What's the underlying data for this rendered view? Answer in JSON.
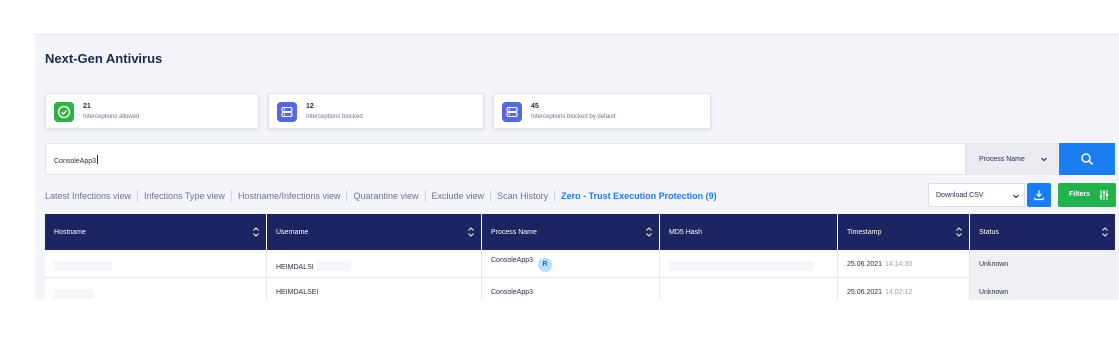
{
  "page": {
    "title": "Next-Gen Antivirus"
  },
  "stats": [
    {
      "count": "21",
      "label": "Interceptions allowed",
      "icon": "check-icon",
      "color": "#2fb344"
    },
    {
      "count": "12",
      "label": "Interceptions blocked",
      "icon": "server-icon",
      "color": "#5867dd"
    },
    {
      "count": "45",
      "label": "Interceptions blocked by default",
      "icon": "server-icon",
      "color": "#5867dd"
    }
  ],
  "search": {
    "value": "ConsoleApp3",
    "field": "Process Name"
  },
  "tabs": [
    "Latest Infections view",
    "Infections Type view",
    "Hostname/Infections view",
    "Quarantine view",
    "Exclude view",
    "Scan History",
    "Zero - Trust Execution Protection (9)"
  ],
  "toolbar": {
    "download_label": "Download CSV",
    "filters_label": "Filters"
  },
  "table": {
    "columns": [
      "Hostname",
      "Username",
      "Process Name",
      "MD5 Hash",
      "Timestamp",
      "Status"
    ],
    "rows": [
      {
        "hostname": "",
        "username": "HEIMDALSI",
        "process": "ConsoleApp3",
        "badge": "R",
        "md5": "",
        "date": "25.06.2021",
        "time": "14:14:30",
        "status": "Unknown"
      },
      {
        "hostname": "",
        "username": "HEIMDALSEI",
        "process": "ConsoleApp3",
        "badge": "",
        "md5": "",
        "date": "25.06.2021",
        "time": "14:02:12",
        "status": "Unknown"
      }
    ]
  }
}
